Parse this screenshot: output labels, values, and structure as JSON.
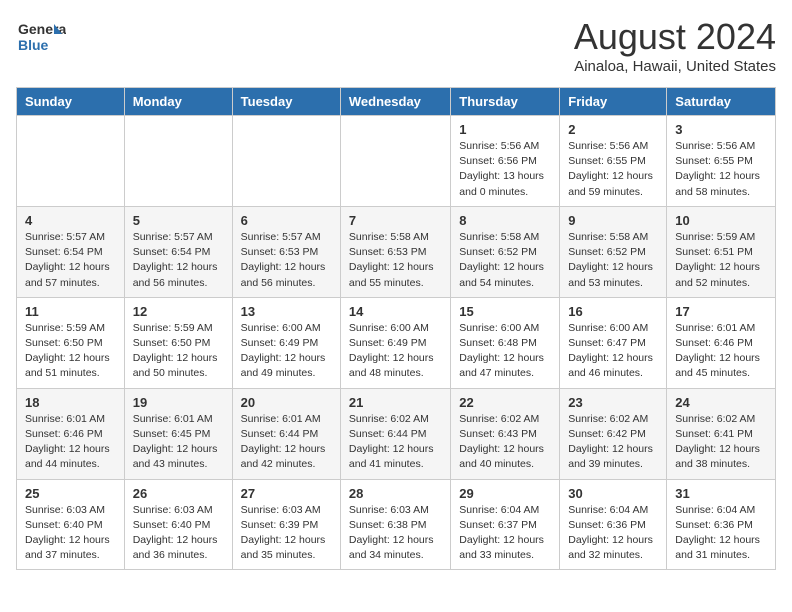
{
  "header": {
    "logo_line1": "General",
    "logo_line2": "Blue",
    "month": "August 2024",
    "location": "Ainaloa, Hawaii, United States"
  },
  "weekdays": [
    "Sunday",
    "Monday",
    "Tuesday",
    "Wednesday",
    "Thursday",
    "Friday",
    "Saturday"
  ],
  "weeks": [
    [
      {
        "day": "",
        "info": ""
      },
      {
        "day": "",
        "info": ""
      },
      {
        "day": "",
        "info": ""
      },
      {
        "day": "",
        "info": ""
      },
      {
        "day": "1",
        "info": "Sunrise: 5:56 AM\nSunset: 6:56 PM\nDaylight: 13 hours\nand 0 minutes."
      },
      {
        "day": "2",
        "info": "Sunrise: 5:56 AM\nSunset: 6:55 PM\nDaylight: 12 hours\nand 59 minutes."
      },
      {
        "day": "3",
        "info": "Sunrise: 5:56 AM\nSunset: 6:55 PM\nDaylight: 12 hours\nand 58 minutes."
      }
    ],
    [
      {
        "day": "4",
        "info": "Sunrise: 5:57 AM\nSunset: 6:54 PM\nDaylight: 12 hours\nand 57 minutes."
      },
      {
        "day": "5",
        "info": "Sunrise: 5:57 AM\nSunset: 6:54 PM\nDaylight: 12 hours\nand 56 minutes."
      },
      {
        "day": "6",
        "info": "Sunrise: 5:57 AM\nSunset: 6:53 PM\nDaylight: 12 hours\nand 56 minutes."
      },
      {
        "day": "7",
        "info": "Sunrise: 5:58 AM\nSunset: 6:53 PM\nDaylight: 12 hours\nand 55 minutes."
      },
      {
        "day": "8",
        "info": "Sunrise: 5:58 AM\nSunset: 6:52 PM\nDaylight: 12 hours\nand 54 minutes."
      },
      {
        "day": "9",
        "info": "Sunrise: 5:58 AM\nSunset: 6:52 PM\nDaylight: 12 hours\nand 53 minutes."
      },
      {
        "day": "10",
        "info": "Sunrise: 5:59 AM\nSunset: 6:51 PM\nDaylight: 12 hours\nand 52 minutes."
      }
    ],
    [
      {
        "day": "11",
        "info": "Sunrise: 5:59 AM\nSunset: 6:50 PM\nDaylight: 12 hours\nand 51 minutes."
      },
      {
        "day": "12",
        "info": "Sunrise: 5:59 AM\nSunset: 6:50 PM\nDaylight: 12 hours\nand 50 minutes."
      },
      {
        "day": "13",
        "info": "Sunrise: 6:00 AM\nSunset: 6:49 PM\nDaylight: 12 hours\nand 49 minutes."
      },
      {
        "day": "14",
        "info": "Sunrise: 6:00 AM\nSunset: 6:49 PM\nDaylight: 12 hours\nand 48 minutes."
      },
      {
        "day": "15",
        "info": "Sunrise: 6:00 AM\nSunset: 6:48 PM\nDaylight: 12 hours\nand 47 minutes."
      },
      {
        "day": "16",
        "info": "Sunrise: 6:00 AM\nSunset: 6:47 PM\nDaylight: 12 hours\nand 46 minutes."
      },
      {
        "day": "17",
        "info": "Sunrise: 6:01 AM\nSunset: 6:46 PM\nDaylight: 12 hours\nand 45 minutes."
      }
    ],
    [
      {
        "day": "18",
        "info": "Sunrise: 6:01 AM\nSunset: 6:46 PM\nDaylight: 12 hours\nand 44 minutes."
      },
      {
        "day": "19",
        "info": "Sunrise: 6:01 AM\nSunset: 6:45 PM\nDaylight: 12 hours\nand 43 minutes."
      },
      {
        "day": "20",
        "info": "Sunrise: 6:01 AM\nSunset: 6:44 PM\nDaylight: 12 hours\nand 42 minutes."
      },
      {
        "day": "21",
        "info": "Sunrise: 6:02 AM\nSunset: 6:44 PM\nDaylight: 12 hours\nand 41 minutes."
      },
      {
        "day": "22",
        "info": "Sunrise: 6:02 AM\nSunset: 6:43 PM\nDaylight: 12 hours\nand 40 minutes."
      },
      {
        "day": "23",
        "info": "Sunrise: 6:02 AM\nSunset: 6:42 PM\nDaylight: 12 hours\nand 39 minutes."
      },
      {
        "day": "24",
        "info": "Sunrise: 6:02 AM\nSunset: 6:41 PM\nDaylight: 12 hours\nand 38 minutes."
      }
    ],
    [
      {
        "day": "25",
        "info": "Sunrise: 6:03 AM\nSunset: 6:40 PM\nDaylight: 12 hours\nand 37 minutes."
      },
      {
        "day": "26",
        "info": "Sunrise: 6:03 AM\nSunset: 6:40 PM\nDaylight: 12 hours\nand 36 minutes."
      },
      {
        "day": "27",
        "info": "Sunrise: 6:03 AM\nSunset: 6:39 PM\nDaylight: 12 hours\nand 35 minutes."
      },
      {
        "day": "28",
        "info": "Sunrise: 6:03 AM\nSunset: 6:38 PM\nDaylight: 12 hours\nand 34 minutes."
      },
      {
        "day": "29",
        "info": "Sunrise: 6:04 AM\nSunset: 6:37 PM\nDaylight: 12 hours\nand 33 minutes."
      },
      {
        "day": "30",
        "info": "Sunrise: 6:04 AM\nSunset: 6:36 PM\nDaylight: 12 hours\nand 32 minutes."
      },
      {
        "day": "31",
        "info": "Sunrise: 6:04 AM\nSunset: 6:36 PM\nDaylight: 12 hours\nand 31 minutes."
      }
    ]
  ]
}
